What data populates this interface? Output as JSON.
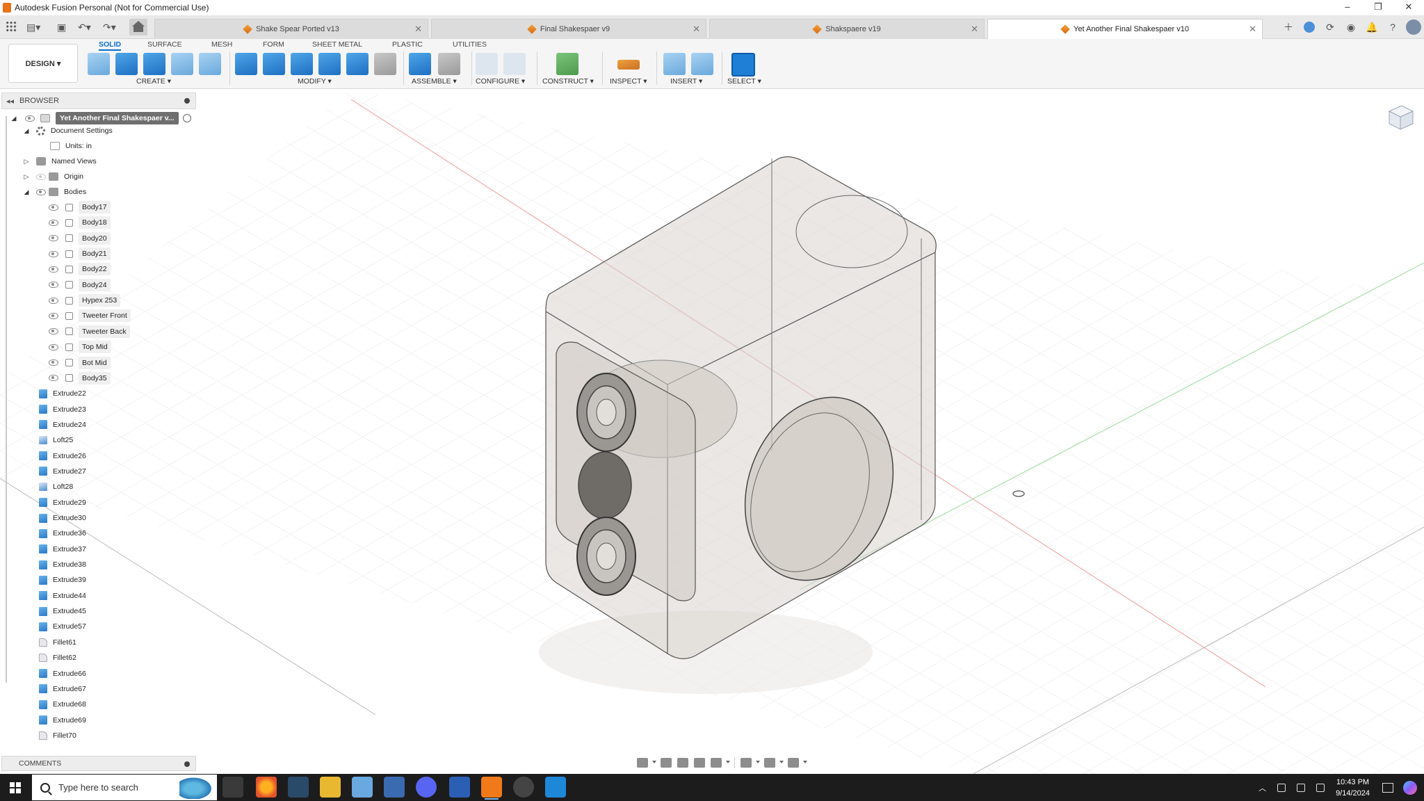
{
  "window": {
    "title": "Autodesk Fusion Personal (Not for Commercial Use)",
    "controls": [
      "–",
      "❐",
      "✕"
    ]
  },
  "tabs": [
    {
      "label": "Shake Spear Ported v13",
      "active": false
    },
    {
      "label": "Final Shakespaer v9",
      "active": false
    },
    {
      "label": "Shakspaere v19",
      "active": false
    },
    {
      "label": "Yet Another Final Shakespaer v10",
      "active": true
    }
  ],
  "toolbar": {
    "workspace": "DESIGN ▾",
    "ribbon_tabs": [
      "SOLID",
      "SURFACE",
      "MESH",
      "FORM",
      "SHEET METAL",
      "PLASTIC",
      "UTILITIES"
    ],
    "groups": [
      "CREATE ▾",
      "MODIFY ▾",
      "ASSEMBLE ▾",
      "CONFIGURE ▾",
      "CONSTRUCT ▾",
      "INSPECT ▾",
      "INSERT ▾",
      "SELECT ▾"
    ]
  },
  "browser": {
    "title": "BROWSER",
    "root": "Yet Another Final Shakespaer v...",
    "document_settings": "Document Settings",
    "units": "Units: in",
    "named_views": "Named Views",
    "origin": "Origin",
    "bodies_label": "Bodies",
    "bodies": [
      "Body17",
      "Body18",
      "Body20",
      "Body21",
      "Body22",
      "Body24",
      "Hypex 253",
      "Tweeter Front",
      "Tweeter Back",
      "Top Mid",
      "Bot Mid",
      "Body35"
    ],
    "features": [
      {
        "label": "Extrude22",
        "kind": "extrude"
      },
      {
        "label": "Extrude23",
        "kind": "extrude"
      },
      {
        "label": "Extrude24",
        "kind": "extrude"
      },
      {
        "label": "Loft25",
        "kind": "loft"
      },
      {
        "label": "Extrude26",
        "kind": "extrude"
      },
      {
        "label": "Extrude27",
        "kind": "extrude"
      },
      {
        "label": "Loft28",
        "kind": "loft"
      },
      {
        "label": "Extrude29",
        "kind": "extrude"
      },
      {
        "label": "Extrude30",
        "kind": "extrude"
      },
      {
        "label": "Extrude36",
        "kind": "extrude"
      },
      {
        "label": "Extrude37",
        "kind": "extrude"
      },
      {
        "label": "Extrude38",
        "kind": "extrude"
      },
      {
        "label": "Extrude39",
        "kind": "extrude"
      },
      {
        "label": "Extrude44",
        "kind": "extrude"
      },
      {
        "label": "Extrude45",
        "kind": "extrude"
      },
      {
        "label": "Extrude57",
        "kind": "extrude"
      },
      {
        "label": "Fillet61",
        "kind": "fillet"
      },
      {
        "label": "Fillet62",
        "kind": "fillet"
      },
      {
        "label": "Extrude66",
        "kind": "extrude"
      },
      {
        "label": "Extrude67",
        "kind": "extrude"
      },
      {
        "label": "Extrude68",
        "kind": "extrude"
      },
      {
        "label": "Extrude69",
        "kind": "extrude"
      },
      {
        "label": "Fillet70",
        "kind": "fillet"
      }
    ]
  },
  "comments": {
    "label": "COMMENTS"
  },
  "taskbar": {
    "search_placeholder": "Type here to search",
    "time": "10:43 PM",
    "date": "9/14/2024"
  },
  "colors": {
    "accent": "#0a6fcc",
    "fusion_orange": "#e8731a",
    "taskbar": "#1c1c1c"
  }
}
